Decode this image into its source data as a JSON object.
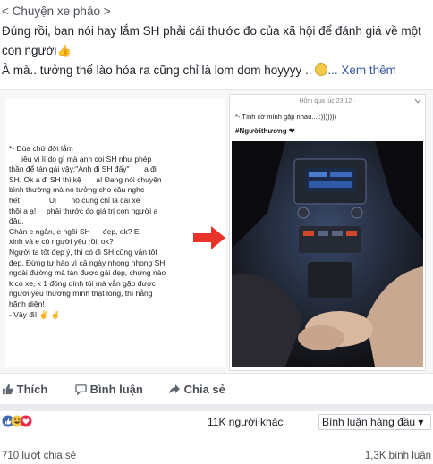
{
  "post": {
    "tag": "< Chuyện xe pháo >",
    "line1": "Đúng rồi, bạn nói hay lắm SH      phải cái thước đo của xã hội để đánh giá về một con người",
    "line2": "À mà.. tưởng thế lào hóa ra cũng chỉ là lom dom hoyyyy ..",
    "see_more": "... Xem thêm"
  },
  "left_screenshot": {
    "text": "*- Đùa chứ đời lắm\n      iều vì lí do gì mà anh coi SH như phép\nthần để tán gái vậy:\"Anh đi SH đấy\"       a đi\nSH. Ok a đi SH thì kệ       a! Đang nói chuyện\nbình thường mà nó tưởng cho câu nghe\nhết              Ui       nó cũng chỉ là cái xe\nthôi a ạ!     phải thước đo giá trị con người a\nđâu.\nChân e ngắn, e ngồi SH      đẹp, ok? E.\nxinh và e có người yêu rồi, ok?\nNgười ta tốt đẹp ý, thì có đi SH cũng vẫn tốt\nđẹp. Đừng tự hào vì cả ngày nhong nhong SH\nngoài đường mà tán được gái đẹp, chứng nào\nk có xe, k 1 đồng dính túi mà vẫn gặp được\nngười yêu thương mình thật lòng, thì hẵng\nhãnh diện!\n- Vậy đi! ✌ ✌"
  },
  "right_screenshot": {
    "timestamp": "Hôm qua lúc 23:12 ·",
    "caption": "*- Tình cờ mình gặp nhau... :)))))))",
    "hashtag": "#Ngườithương ❤"
  },
  "actions": {
    "like": "Thích",
    "comment": "Bình luận",
    "share": "Chia sẻ"
  },
  "reactions": {
    "count": "11K người khác",
    "sort_label": "Bình luận hàng đầu ▾"
  },
  "footer": {
    "shares": "710 lượt chia sẻ",
    "comments": "1,3K bình luận"
  },
  "colors": {
    "link": "#365899",
    "arrow": "#e8332a",
    "like_blue": "#4267b2",
    "love_red": "#f0284a"
  }
}
